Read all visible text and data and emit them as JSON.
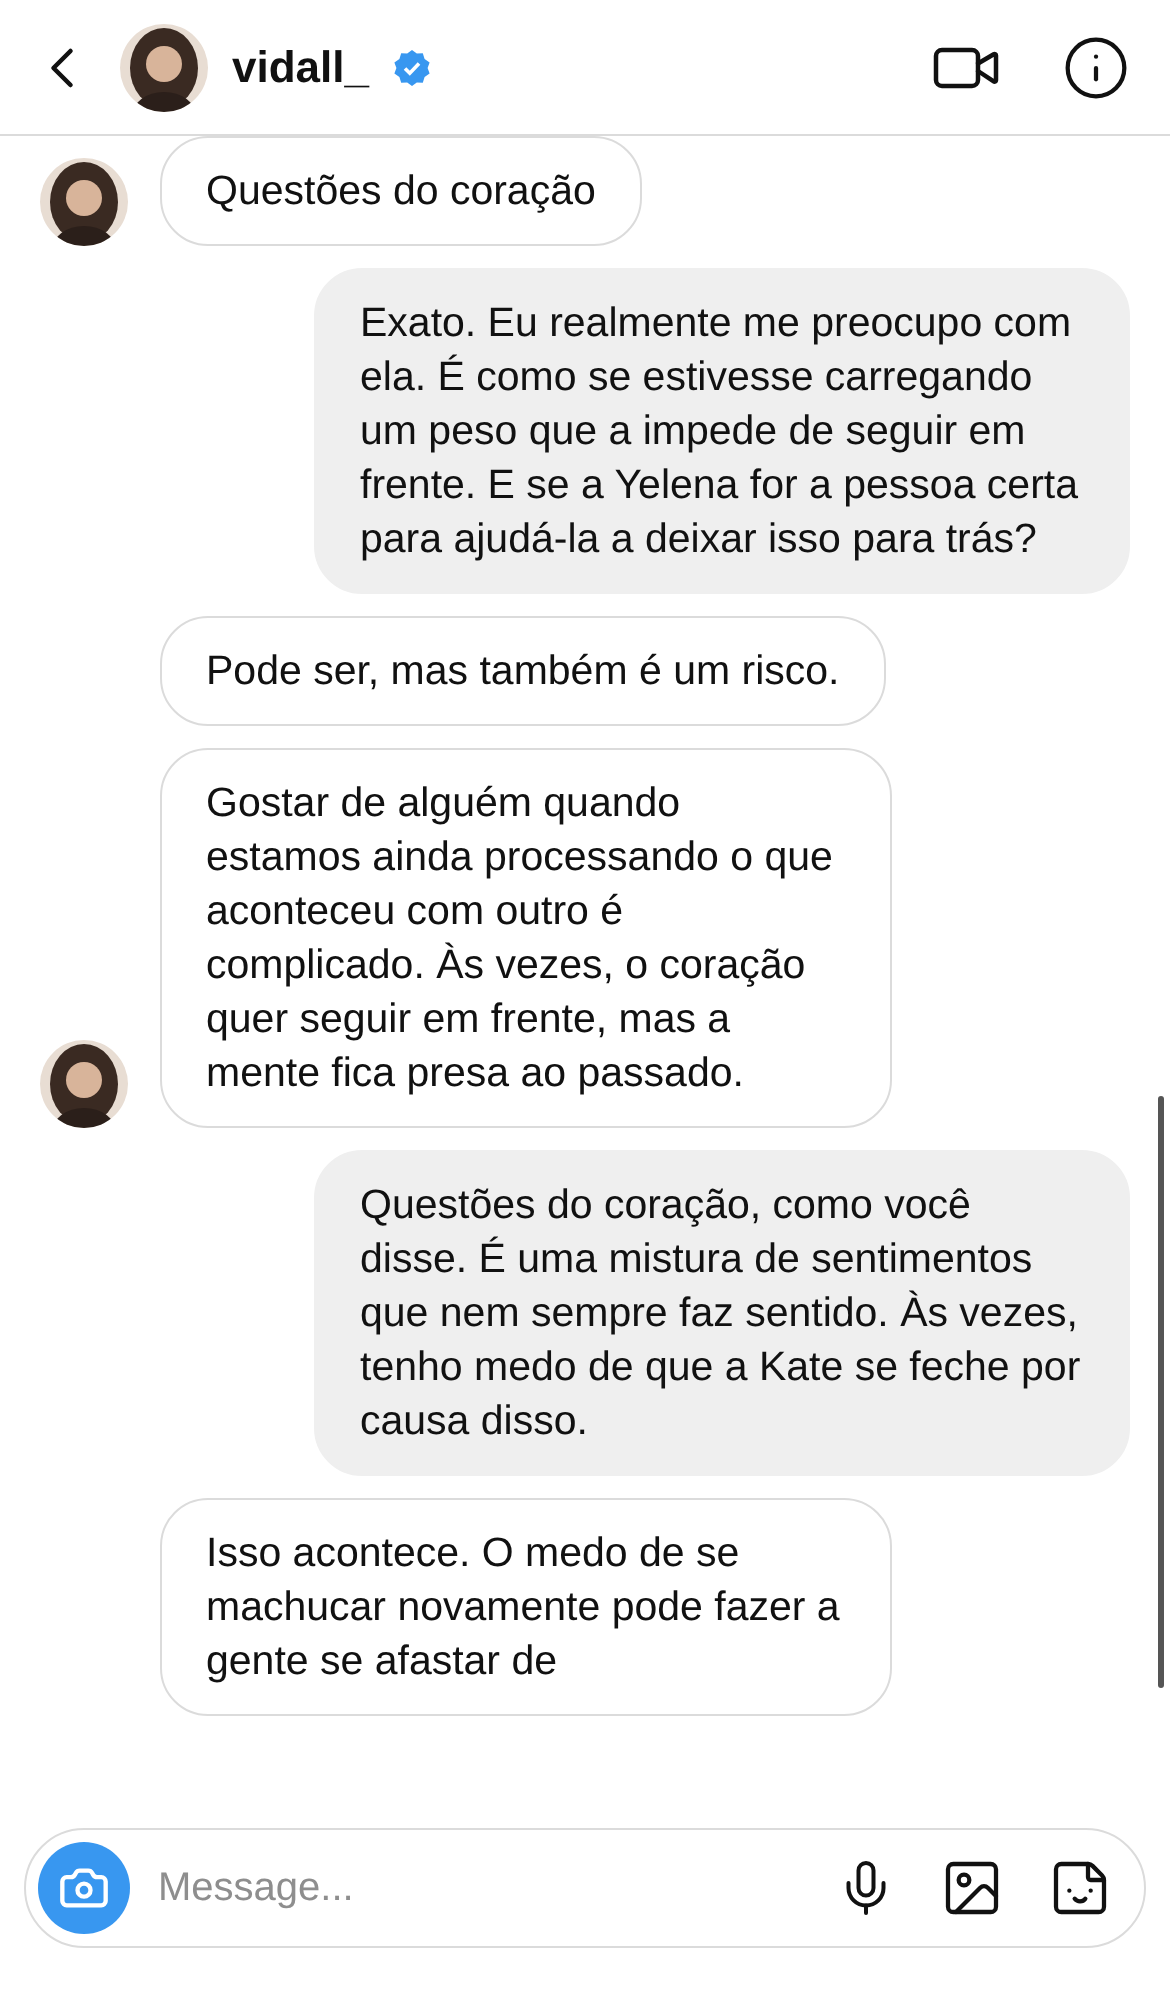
{
  "header": {
    "username": "vidall_",
    "verified": true
  },
  "messages": [
    {
      "outgoing": false,
      "show_avatar": true,
      "text": "Questões do coração"
    },
    {
      "outgoing": true,
      "text": "Exato. Eu realmente me preocupo com ela. É como se estivesse carregando um peso que a impede de seguir em frente. E se a Yelena for a pessoa certa para ajudá-la a deixar isso para trás?"
    },
    {
      "outgoing": false,
      "show_avatar": false,
      "text": "Pode ser, mas também é um risco."
    },
    {
      "outgoing": false,
      "show_avatar": true,
      "text": "Gostar de alguém quando estamos ainda processando o que aconteceu com outro é complicado. Às vezes, o coração quer seguir em frente, mas a mente fica presa ao passado."
    },
    {
      "outgoing": true,
      "text": "Questões do coração, como você disse. É uma mistura de sentimentos que nem sempre faz sentido. Às vezes, tenho medo de que a Kate se feche por causa disso."
    },
    {
      "outgoing": false,
      "show_avatar": false,
      "text": "Isso acontece. O medo de se machucar novamente pode fazer a gente se afastar de"
    }
  ],
  "composer": {
    "placeholder": "Message..."
  }
}
